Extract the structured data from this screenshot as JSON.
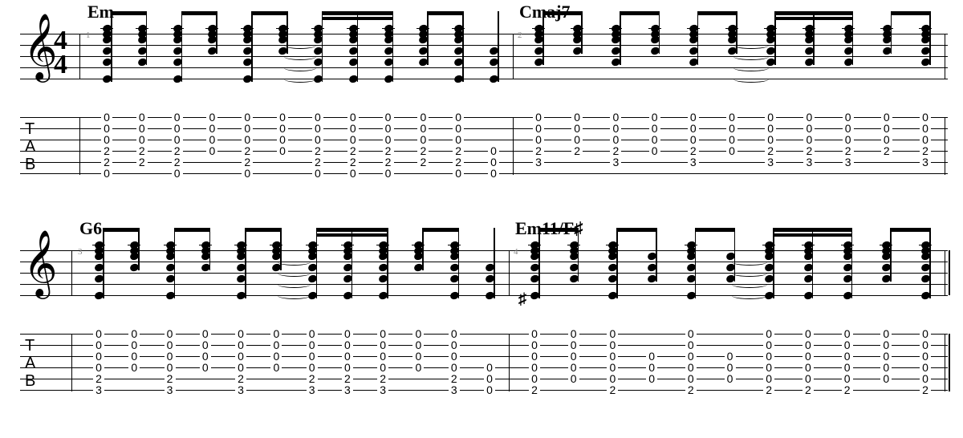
{
  "time_signature": {
    "numerator": "4",
    "denominator": "4"
  },
  "tab_letters": [
    "T",
    "A",
    "B"
  ],
  "systems": [
    {
      "measures": [
        {
          "number": "1",
          "chord": "Em",
          "columns": [
            {
              "s": [
                0,
                1,
                2,
                3,
                4,
                5
              ],
              "f": [
                "0",
                "0",
                "0",
                "2",
                "2",
                "0"
              ]
            },
            {
              "s": [
                0,
                1,
                2,
                3,
                4
              ],
              "f": [
                "0",
                "0",
                "0",
                "2",
                "2"
              ]
            },
            {
              "s": [
                0,
                1,
                2,
                3,
                4,
                5
              ],
              "f": [
                "0",
                "0",
                "0",
                "2",
                "2",
                "0"
              ]
            },
            {
              "s": [
                0,
                1,
                2,
                3
              ],
              "f": [
                "0",
                "0",
                "0",
                "0"
              ]
            },
            {
              "s": [
                0,
                1,
                2,
                3,
                4,
                5
              ],
              "f": [
                "0",
                "0",
                "0",
                "2",
                "2",
                "0"
              ]
            },
            {
              "s": [
                0,
                1,
                2,
                3
              ],
              "f": [
                "0",
                "0",
                "0",
                "0"
              ]
            },
            {
              "s": [
                0,
                1,
                2,
                3,
                4,
                5
              ],
              "f": [
                "0",
                "0",
                "0",
                "2",
                "2",
                "0"
              ]
            },
            {
              "s": [
                0,
                1,
                2,
                3,
                4,
                5
              ],
              "f": [
                "0",
                "0",
                "0",
                "2",
                "2",
                "0"
              ]
            },
            {
              "s": [
                0,
                1,
                2,
                3,
                4,
                5
              ],
              "f": [
                "0",
                "0",
                "0",
                "2",
                "2",
                "0"
              ]
            },
            {
              "s": [
                0,
                1,
                2,
                3,
                4
              ],
              "f": [
                "0",
                "0",
                "0",
                "2",
                "2"
              ]
            },
            {
              "s": [
                0,
                1,
                2,
                3,
                4,
                5
              ],
              "f": [
                "0",
                "0",
                "0",
                "2",
                "2",
                "0"
              ]
            },
            {
              "s": [
                3,
                4,
                5
              ],
              "f": [
                "0",
                "0",
                "0"
              ]
            }
          ]
        },
        {
          "number": "2",
          "chord": "Cmaj7",
          "columns": [
            {
              "s": [
                0,
                1,
                2,
                3,
                4
              ],
              "f": [
                "0",
                "0",
                "0",
                "2",
                "3"
              ]
            },
            {
              "s": [
                0,
                1,
                2,
                3
              ],
              "f": [
                "0",
                "0",
                "0",
                "2"
              ]
            },
            {
              "s": [
                0,
                1,
                2,
                3,
                4
              ],
              "f": [
                "0",
                "0",
                "0",
                "2",
                "3"
              ]
            },
            {
              "s": [
                0,
                1,
                2,
                3
              ],
              "f": [
                "0",
                "0",
                "0",
                "0"
              ]
            },
            {
              "s": [
                0,
                1,
                2,
                3,
                4
              ],
              "f": [
                "0",
                "0",
                "0",
                "2",
                "3"
              ]
            },
            {
              "s": [
                0,
                1,
                2,
                3
              ],
              "f": [
                "0",
                "0",
                "0",
                "0"
              ]
            },
            {
              "s": [
                0,
                1,
                2,
                3,
                4
              ],
              "f": [
                "0",
                "0",
                "0",
                "2",
                "3"
              ]
            },
            {
              "s": [
                0,
                1,
                2,
                3,
                4
              ],
              "f": [
                "0",
                "0",
                "0",
                "2",
                "3"
              ]
            },
            {
              "s": [
                0,
                1,
                2,
                3,
                4
              ],
              "f": [
                "0",
                "0",
                "0",
                "2",
                "3"
              ]
            },
            {
              "s": [
                0,
                1,
                2,
                3
              ],
              "f": [
                "0",
                "0",
                "0",
                "2"
              ]
            },
            {
              "s": [
                0,
                1,
                2,
                3,
                4
              ],
              "f": [
                "0",
                "0",
                "0",
                "2",
                "3"
              ]
            }
          ]
        }
      ]
    },
    {
      "measures": [
        {
          "number": "3",
          "chord": "G6",
          "columns": [
            {
              "s": [
                0,
                1,
                2,
                3,
                4,
                5
              ],
              "f": [
                "0",
                "0",
                "0",
                "0",
                "2",
                "3"
              ]
            },
            {
              "s": [
                0,
                1,
                2,
                3
              ],
              "f": [
                "0",
                "0",
                "0",
                "0"
              ]
            },
            {
              "s": [
                0,
                1,
                2,
                3,
                4,
                5
              ],
              "f": [
                "0",
                "0",
                "0",
                "0",
                "2",
                "3"
              ]
            },
            {
              "s": [
                0,
                1,
                2,
                3
              ],
              "f": [
                "0",
                "0",
                "0",
                "0"
              ]
            },
            {
              "s": [
                0,
                1,
                2,
                3,
                4,
                5
              ],
              "f": [
                "0",
                "0",
                "0",
                "0",
                "2",
                "3"
              ]
            },
            {
              "s": [
                0,
                1,
                2,
                3
              ],
              "f": [
                "0",
                "0",
                "0",
                "0"
              ]
            },
            {
              "s": [
                0,
                1,
                2,
                3,
                4,
                5
              ],
              "f": [
                "0",
                "0",
                "0",
                "0",
                "2",
                "3"
              ]
            },
            {
              "s": [
                0,
                1,
                2,
                3,
                4,
                5
              ],
              "f": [
                "0",
                "0",
                "0",
                "0",
                "2",
                "3"
              ]
            },
            {
              "s": [
                0,
                1,
                2,
                3,
                4,
                5
              ],
              "f": [
                "0",
                "0",
                "0",
                "0",
                "2",
                "3"
              ]
            },
            {
              "s": [
                0,
                1,
                2,
                3
              ],
              "f": [
                "0",
                "0",
                "0",
                "0"
              ]
            },
            {
              "s": [
                0,
                1,
                2,
                3,
                4,
                5
              ],
              "f": [
                "0",
                "0",
                "0",
                "0",
                "2",
                "3"
              ]
            },
            {
              "s": [
                3,
                4,
                5
              ],
              "f": [
                "0",
                "0",
                "0"
              ]
            }
          ]
        },
        {
          "number": "4",
          "chord": "Em11/F♯",
          "columns": [
            {
              "s": [
                0,
                1,
                2,
                3,
                4,
                5
              ],
              "f": [
                "0",
                "0",
                "0",
                "0",
                "0",
                "2"
              ]
            },
            {
              "s": [
                0,
                1,
                2,
                3,
                4
              ],
              "f": [
                "0",
                "0",
                "0",
                "0",
                "0"
              ]
            },
            {
              "s": [
                0,
                1,
                2,
                3,
                4,
                5
              ],
              "f": [
                "0",
                "0",
                "0",
                "0",
                "0",
                "2"
              ]
            },
            {
              "s": [
                2,
                3,
                4
              ],
              "f": [
                "0",
                "0",
                "0"
              ]
            },
            {
              "s": [
                0,
                1,
                2,
                3,
                4,
                5
              ],
              "f": [
                "0",
                "0",
                "0",
                "0",
                "0",
                "2"
              ]
            },
            {
              "s": [
                2,
                3,
                4
              ],
              "f": [
                "0",
                "0",
                "0"
              ]
            },
            {
              "s": [
                0,
                1,
                2,
                3,
                4,
                5
              ],
              "f": [
                "0",
                "0",
                "0",
                "0",
                "0",
                "2"
              ]
            },
            {
              "s": [
                0,
                1,
                2,
                3,
                4,
                5
              ],
              "f": [
                "0",
                "0",
                "0",
                "0",
                "0",
                "2"
              ]
            },
            {
              "s": [
                0,
                1,
                2,
                3,
                4,
                5
              ],
              "f": [
                "0",
                "0",
                "0",
                "0",
                "0",
                "2"
              ]
            },
            {
              "s": [
                0,
                1,
                2,
                3,
                4
              ],
              "f": [
                "0",
                "0",
                "0",
                "0",
                "0"
              ]
            },
            {
              "s": [
                0,
                1,
                2,
                3,
                4,
                5
              ],
              "f": [
                "0",
                "0",
                "0",
                "0",
                "0",
                "2"
              ]
            }
          ]
        }
      ]
    }
  ]
}
